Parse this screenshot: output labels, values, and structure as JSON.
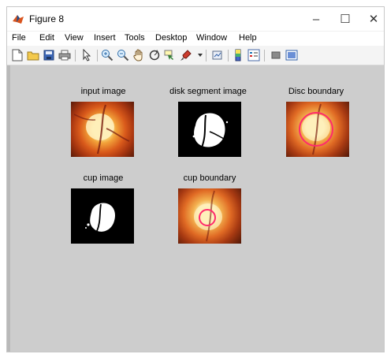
{
  "window": {
    "title": "Figure 8",
    "controls": {
      "minimize": "–",
      "maximize": "☐",
      "close": "✕"
    }
  },
  "menu": {
    "items": [
      "File",
      "Edit",
      "View",
      "Insert",
      "Tools",
      "Desktop",
      "Window",
      "Help"
    ]
  },
  "toolbar": {
    "buttons": [
      "new-figure",
      "open-file",
      "save",
      "print",
      "edit-plot",
      "zoom-in",
      "zoom-out",
      "pan",
      "rotate-3d",
      "data-cursor",
      "brush",
      "link",
      "insert-colorbar",
      "insert-legend",
      "hide-plot-tools",
      "show-plot-tools"
    ]
  },
  "panels": {
    "input": {
      "title": "input image"
    },
    "disk_segment": {
      "title": "disk segment image"
    },
    "disc_boundary": {
      "title": "Disc boundary"
    },
    "cup": {
      "title": "cup image"
    },
    "cup_boundary": {
      "title": "cup boundary"
    }
  },
  "colors": {
    "plot_background": "#cdcdcd",
    "boundary": "#ff2a6d"
  }
}
